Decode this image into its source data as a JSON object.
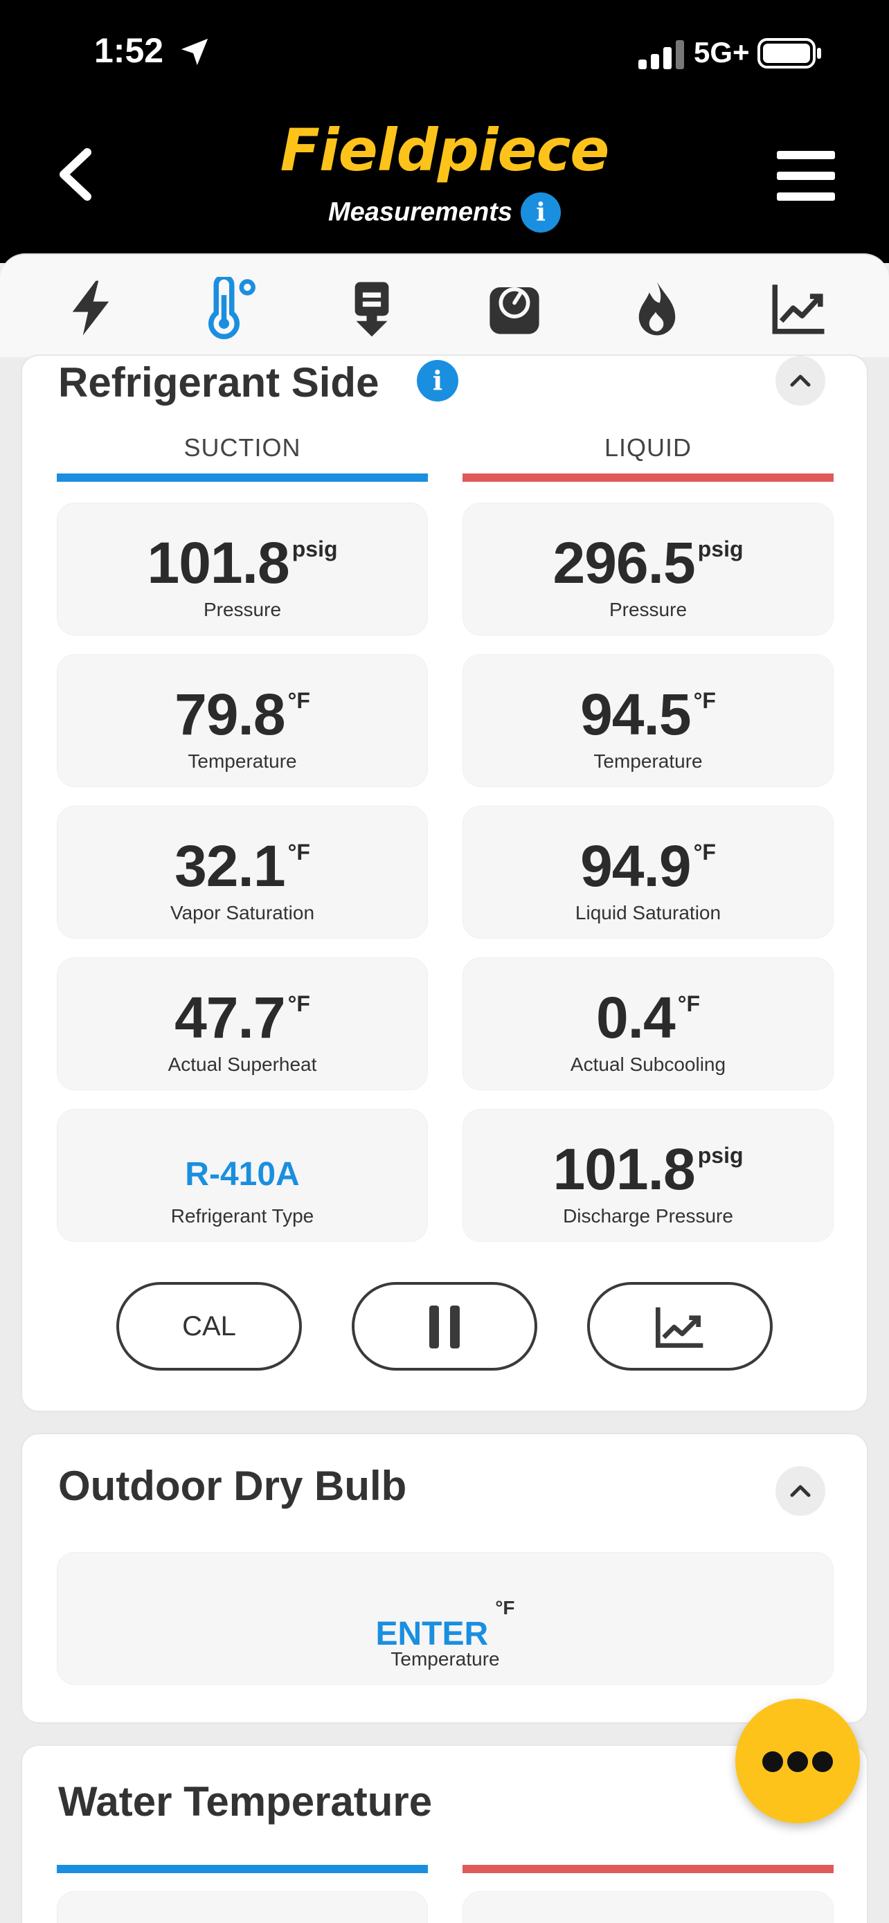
{
  "status": {
    "time": "1:52",
    "network": "5G+"
  },
  "header": {
    "brand": "Fieldpiece",
    "subtitle": "Measurements",
    "info": "i"
  },
  "refrigerant": {
    "title": "Refrigerant Side",
    "info": "i",
    "col_suction": "SUCTION",
    "col_liquid": "LIQUID",
    "suction": [
      {
        "value": "101.8",
        "unit": "psig",
        "label": "Pressure"
      },
      {
        "value": "79.8",
        "unit": "°F",
        "label": "Temperature"
      },
      {
        "value": "32.1",
        "unit": "°F",
        "label": "Vapor Saturation"
      },
      {
        "value": "47.7",
        "unit": "°F",
        "label": "Actual Superheat"
      },
      {
        "value": "R-410A",
        "unit": "",
        "label": "Refrigerant Type"
      }
    ],
    "liquid": [
      {
        "value": "296.5",
        "unit": "psig",
        "label": "Pressure"
      },
      {
        "value": "94.5",
        "unit": "°F",
        "label": "Temperature"
      },
      {
        "value": "94.9",
        "unit": "°F",
        "label": "Liquid Saturation"
      },
      {
        "value": "0.4",
        "unit": "°F",
        "label": "Actual Subcooling"
      },
      {
        "value": "101.8",
        "unit": "psig",
        "label": "Discharge Pressure"
      }
    ],
    "cal_label": "CAL"
  },
  "outdoor": {
    "title": "Outdoor Dry Bulb",
    "value": "ENTER",
    "unit": "°F",
    "label": "Temperature"
  },
  "water": {
    "title": "Water Temperature"
  },
  "colors": {
    "brand": "#fdc31b",
    "accent": "#1a8fe0",
    "suction": "#1a8fe0",
    "liquid": "#e05a5a"
  }
}
